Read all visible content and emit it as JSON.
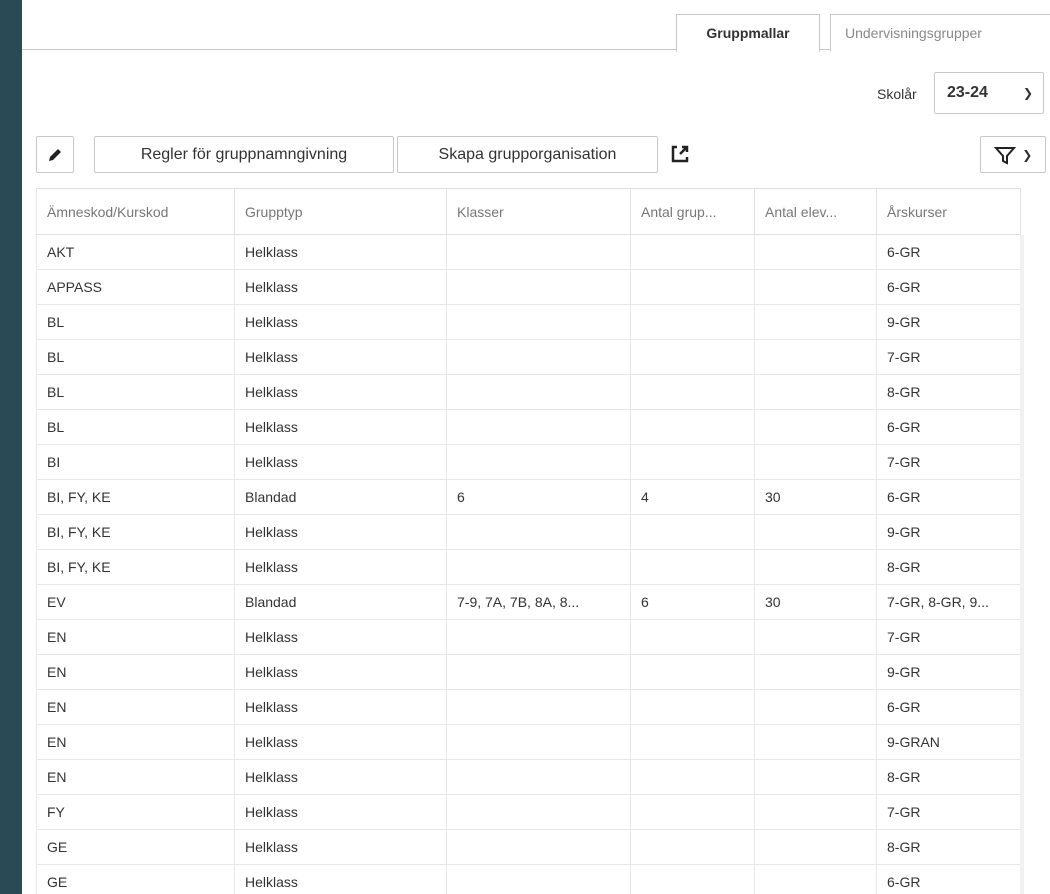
{
  "tabs": [
    {
      "label": "Gruppmallar",
      "active": true
    },
    {
      "label": "Undervisningsgrupper",
      "active": false
    }
  ],
  "school_year": {
    "label": "Skolår",
    "value": "23-24"
  },
  "toolbar": {
    "rules_label": "Regler för gruppnamngivning",
    "create_label": "Skapa grupporganisation"
  },
  "icons": {
    "edit": "pencil-icon",
    "export": "external-link-icon",
    "filter": "filter-icon"
  },
  "table": {
    "columns": [
      "Ämneskod/Kurskod",
      "Grupptyp",
      "Klasser",
      "Antal grup...",
      "Antal elev...",
      "Årskurser"
    ],
    "rows": [
      [
        "AKT",
        "Helklass",
        "",
        "",
        "",
        "6-GR"
      ],
      [
        "APPASS",
        "Helklass",
        "",
        "",
        "",
        "6-GR"
      ],
      [
        "BL",
        "Helklass",
        "",
        "",
        "",
        "9-GR"
      ],
      [
        "BL",
        "Helklass",
        "",
        "",
        "",
        "7-GR"
      ],
      [
        "BL",
        "Helklass",
        "",
        "",
        "",
        "8-GR"
      ],
      [
        "BL",
        "Helklass",
        "",
        "",
        "",
        "6-GR"
      ],
      [
        "BI",
        "Helklass",
        "",
        "",
        "",
        "7-GR"
      ],
      [
        "BI, FY, KE",
        "Blandad",
        "6",
        "4",
        "30",
        "6-GR"
      ],
      [
        "BI, FY, KE",
        "Helklass",
        "",
        "",
        "",
        "9-GR"
      ],
      [
        "BI, FY, KE",
        "Helklass",
        "",
        "",
        "",
        "8-GR"
      ],
      [
        "EV",
        "Blandad",
        "7-9, 7A, 7B, 8A, 8...",
        "6",
        "30",
        "7-GR, 8-GR, 9..."
      ],
      [
        "EN",
        "Helklass",
        "",
        "",
        "",
        "7-GR"
      ],
      [
        "EN",
        "Helklass",
        "",
        "",
        "",
        "9-GR"
      ],
      [
        "EN",
        "Helklass",
        "",
        "",
        "",
        "6-GR"
      ],
      [
        "EN",
        "Helklass",
        "",
        "",
        "",
        "9-GRAN"
      ],
      [
        "EN",
        "Helklass",
        "",
        "",
        "",
        "8-GR"
      ],
      [
        "FY",
        "Helklass",
        "",
        "",
        "",
        "7-GR"
      ],
      [
        "GE",
        "Helklass",
        "",
        "",
        "",
        "8-GR"
      ],
      [
        "GE",
        "Helklass",
        "",
        "",
        "",
        "6-GR"
      ]
    ]
  }
}
